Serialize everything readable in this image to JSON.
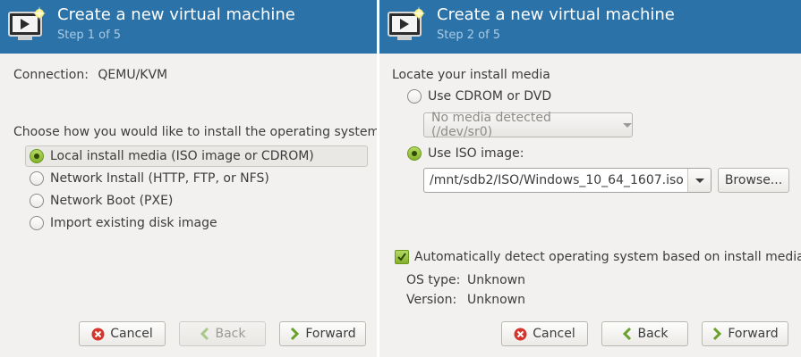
{
  "colors": {
    "header_bg": "#2a72a7",
    "panel_bg": "#f2f1f0",
    "accent_green": "#85b12c"
  },
  "left": {
    "header": {
      "title": "Create a new virtual machine",
      "step": "Step 1 of 5"
    },
    "connection": {
      "label": "Connection:",
      "value": "QEMU/KVM"
    },
    "install_prompt": "Choose how you would like to install the operating system",
    "options": [
      {
        "label": "Local install media (ISO image or CDROM)",
        "checked": true
      },
      {
        "label": "Network Install (HTTP, FTP, or NFS)",
        "checked": false
      },
      {
        "label": "Network Boot (PXE)",
        "checked": false
      },
      {
        "label": "Import existing disk image",
        "checked": false
      }
    ],
    "buttons": {
      "cancel": "Cancel",
      "back": "Back",
      "forward": "Forward"
    }
  },
  "right": {
    "header": {
      "title": "Create a new virtual machine",
      "step": "Step 2 of 5"
    },
    "locate_label": "Locate your install media",
    "cdrom_option": "Use CDROM or DVD",
    "cdrom_combo": "No media detected (/dev/sr0)",
    "iso_option": "Use ISO image:",
    "iso_path": "/mnt/sdb2/ISO/Windows_10_64_1607.iso",
    "browse": "Browse...",
    "auto_detect": "Automatically detect operating system based on install media",
    "os_type": {
      "label": "OS type:",
      "value": "Unknown"
    },
    "version": {
      "label": "Version:",
      "value": "Unknown"
    },
    "buttons": {
      "cancel": "Cancel",
      "back": "Back",
      "forward": "Forward"
    }
  }
}
